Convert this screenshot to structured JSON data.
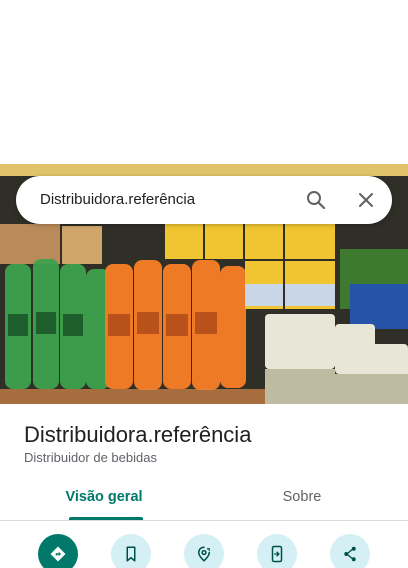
{
  "search": {
    "query": "Distribuidora.referência",
    "search_icon": "search-icon",
    "close_icon": "close-icon"
  },
  "place": {
    "title": "Distribuidora.referência",
    "category": "Distribuidor de bebidas"
  },
  "tabs": [
    {
      "label": "Visão geral",
      "active": true
    },
    {
      "label": "Sobre",
      "active": false
    }
  ],
  "actions": [
    {
      "icon": "directions-icon"
    },
    {
      "icon": "bookmark-icon"
    },
    {
      "icon": "nearby-icon"
    },
    {
      "icon": "send-to-phone-icon"
    },
    {
      "icon": "share-icon"
    }
  ],
  "colors": {
    "accent": "#00796b",
    "action_bg": "#d5f0f5"
  }
}
